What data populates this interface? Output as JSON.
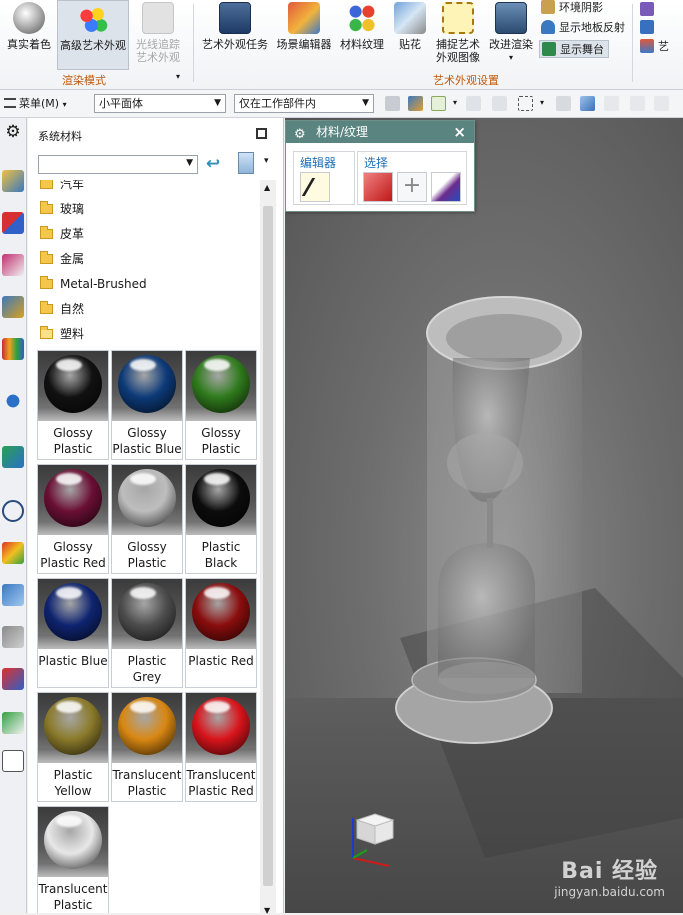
{
  "ribbon": {
    "buttons": [
      {
        "label": "真实着色"
      },
      {
        "label": "高级艺术外观"
      },
      {
        "label": "光线追踪艺术外观"
      },
      {
        "label": "艺术外观任务"
      },
      {
        "label": "场景编辑器"
      },
      {
        "label": "材料纹理"
      },
      {
        "label": "贴花"
      },
      {
        "label": "捕捉艺术外观图像"
      },
      {
        "label": "改进渲染"
      }
    ],
    "small_items": [
      {
        "label": "环境阴影"
      },
      {
        "label": "显示地板反射"
      },
      {
        "label": "显示舞台"
      },
      {
        "label": "艺"
      }
    ],
    "group_render_mode": "渲染模式",
    "group_art_settings": "艺术外观设置"
  },
  "toolbar": {
    "menu_label": "菜单(M)",
    "filter_select": "小平面体",
    "scope_select": "仅在工作部件内"
  },
  "library": {
    "title": "系统材料",
    "combo_value": "",
    "folders": [
      "汽车",
      "玻璃",
      "皮革",
      "金属",
      "Metal-Brushed",
      "自然",
      "塑料"
    ],
    "materials": [
      {
        "name": "Glossy Plastic",
        "color": "#111111"
      },
      {
        "name": "Glossy Plastic Blue",
        "color": "#0d3a78"
      },
      {
        "name": "Glossy Plastic",
        "color": "#2f7a1c"
      },
      {
        "name": "Glossy Plastic Red",
        "color": "#6a0f35"
      },
      {
        "name": "Glossy Plastic",
        "color": "#bdbdbd"
      },
      {
        "name": "Plastic Black",
        "color": "#0c0c0c"
      },
      {
        "name": "Plastic Blue",
        "color": "#0f2470"
      },
      {
        "name": "Plastic Grey",
        "color": "#4d4d4d"
      },
      {
        "name": "Plastic Red",
        "color": "#8a0d0d"
      },
      {
        "name": "Plastic Yellow",
        "color": "#8a7a2a"
      },
      {
        "name": "Translucent Plastic",
        "color": "#d88712"
      },
      {
        "name": "Translucent Plastic Red",
        "color": "#d8141b"
      },
      {
        "name": "Translucent Plastic",
        "color": "#e7e7e7"
      }
    ]
  },
  "material_dialog": {
    "title": "材料/纹理",
    "group_editor": "编辑器",
    "group_select": "选择"
  },
  "watermark": {
    "line1": "Bai 经验",
    "line2": "jingyan.baidu.com"
  },
  "colors": {
    "dialog_title": "#5a8480",
    "group_label": "#c0580a",
    "link_blue": "#1f6fb5"
  }
}
